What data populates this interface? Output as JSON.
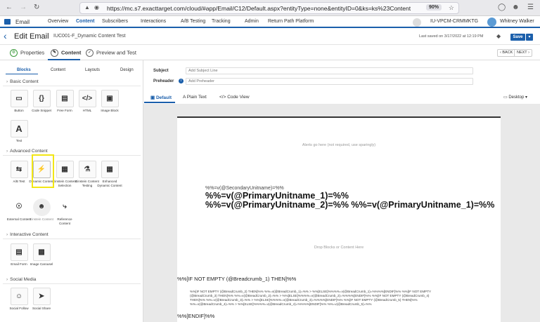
{
  "browser": {
    "url": "https://mc.s7.exacttarget.com/cloud/#app/Email/C12/Default.aspx?entityType=none&entityID=0&ks=ks%23Content",
    "zoom": "90%"
  },
  "app": {
    "name": "Email",
    "nav": [
      "Overview",
      "Content",
      "Subscribers",
      "Interactions",
      "A/B Testing",
      "Tracking",
      "Admin",
      "Return Path Platform"
    ],
    "account": "IU-VPCM-CRMMKTG",
    "user": "Whitney Walker"
  },
  "header": {
    "title": "Edit Email",
    "email_name": "IUC001-F_Dynamic Content Test",
    "last_saved": "Last saved on 3/17/2022 at 12:19 PM",
    "save": "Save"
  },
  "steps": {
    "properties": "Properties",
    "content": "Content",
    "preview": "Preview and Test",
    "back": "‹ BACK",
    "next": "NEXT ›"
  },
  "left": {
    "tabs": [
      "Blocks",
      "Content",
      "Layouts",
      "Design"
    ],
    "sections": {
      "basic": "Basic Content",
      "advanced": "Advanced Content",
      "interactive": "Interactive Content",
      "social": "Social Media"
    },
    "basic_blocks": [
      "Button",
      "Code Snippet",
      "Free Form",
      "HTML",
      "Image Block",
      "Text"
    ],
    "advanced_blocks": [
      "A/B Test",
      "Dynamic Content",
      "Einstein Content Selection",
      "Einstein Content Testing",
      "Enhanced Dynamic Content",
      "External Content",
      "Einstein Content",
      "Reference Content"
    ],
    "interactive_blocks": [
      "Email Form",
      "Image Carousel"
    ],
    "social_blocks": [
      "Social Follow",
      "Social Share"
    ]
  },
  "fields": {
    "subject_label": "Subject",
    "subject_placeholder": "Add Subject Line",
    "preheader_label": "Preheader",
    "preheader_placeholder": "Add Preheader"
  },
  "view_tabs": [
    "Default",
    "Plain Text",
    "Code View"
  ],
  "device": "Desktop",
  "canvas": {
    "alerts": "Alerts go here (not required, use sparingly)",
    "secondary": "%%=v(@SecondaryUnitname)=%%",
    "primary1": "%%=v(@PrimaryUnitname_1)=%%",
    "primary2": "%%=v(@PrimaryUnitname_2)=%% %%=v(@PrimaryUnitname_1)=%%",
    "drop": "Drop Blocks or Content Here",
    "if_line": "%%[IF NOT EMPTY (@Breadcrumb_1) THEN]%%",
    "code_lines": [
      "%%[IF NOT EMPTY (@BreadCrumb_2) THEN]%% %%=v(@BreadCrumb_1)=%% > %%[ELSE]%%%%=v(@BreadCrumb_1)=%%%%[ENDIF]%% %%[IF NOT EMPTY",
      "(@BreadCrumb_3) THEN]%% %%=v(@BreadCrumb_2)=%% > %%[ELSE]%%%%=v(@BreadCrumb_2)=%%%%[ENDIF]%% %%[IF NOT EMPTY (@BreadCrumb_4)",
      "THEN]%% %%=v(@BreadCrumb_3)=%% > %%[ELSE]%%%%=v(@BreadCrumb_3)=%%%%[ENDIF]%% %%[IF NOT EMPTY (@BreadCrumb_5) THEN]%%",
      "%%=v(@BreadCrumb_4)=%% > %%[ELSE]%%%%=v(@BreadCrumb_4)=%%%%[ENDIF]%% %%=v(@BreadCrumb_5)=%%"
    ],
    "endif": "%%[ENDIF]%%"
  }
}
